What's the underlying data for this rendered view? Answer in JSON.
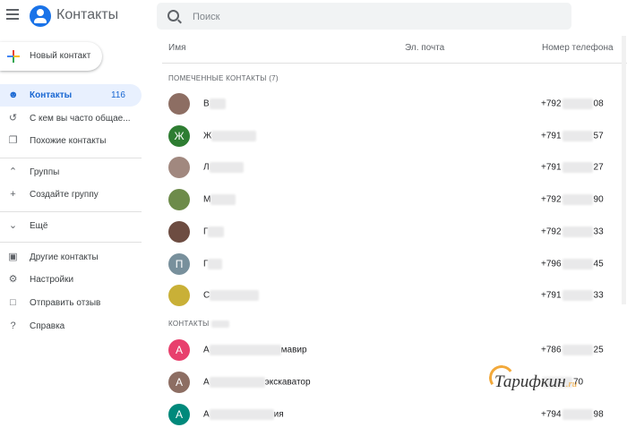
{
  "app": {
    "title": "Контакты"
  },
  "search": {
    "placeholder": "Поиск"
  },
  "new_contact": {
    "label": "Новый контакт"
  },
  "sidebar": {
    "items": [
      {
        "label": "Контакты",
        "count": "116",
        "icon": "person-icon"
      },
      {
        "label": "С кем вы часто общае...",
        "icon": "history-icon"
      },
      {
        "label": "Похожие контакты",
        "icon": "copy-icon"
      },
      {
        "label": "Группы",
        "icon": "chevron-up-icon"
      },
      {
        "label": "Создайте группу",
        "icon": "plus-icon"
      },
      {
        "label": "Ещё",
        "icon": "chevron-down-icon"
      },
      {
        "label": "Другие контакты",
        "icon": "archive-icon"
      },
      {
        "label": "Настройки",
        "icon": "gear-icon"
      },
      {
        "label": "Отправить отзыв",
        "icon": "feedback-icon"
      },
      {
        "label": "Справка",
        "icon": "help-icon"
      }
    ]
  },
  "columns": {
    "name": "Имя",
    "email": "Эл. почта",
    "phone": "Номер телефона"
  },
  "starred": {
    "title": "ПОМЕЧЕННЫЕ КОНТАКТЫ (7)",
    "rows": [
      {
        "initial": "",
        "name_start": "В",
        "name_end": "",
        "phone_start": "+792",
        "phone_end": "08",
        "avatar_color": "#8d6e63"
      },
      {
        "initial": "Ж",
        "name_start": "Ж",
        "name_end": "",
        "phone_start": "+791",
        "phone_end": "57",
        "avatar_color": "#2e7d32"
      },
      {
        "initial": "",
        "name_start": "Л",
        "name_end": "",
        "phone_start": "+791",
        "phone_end": "27",
        "avatar_color": "#a1887f"
      },
      {
        "initial": "",
        "name_start": "М",
        "name_end": "",
        "phone_start": "+792",
        "phone_end": "90",
        "avatar_color": "#6d8b4a"
      },
      {
        "initial": "",
        "name_start": "Г",
        "name_end": "",
        "phone_start": "+792",
        "phone_end": "33",
        "avatar_color": "#6d4c41"
      },
      {
        "initial": "П",
        "name_start": "Г",
        "name_end": "",
        "phone_start": "+796",
        "phone_end": "45",
        "avatar_color": "#78909c"
      },
      {
        "initial": "",
        "name_start": "С",
        "name_end": "",
        "phone_start": "+791",
        "phone_end": "33",
        "avatar_color": "#c9b037"
      }
    ]
  },
  "contacts": {
    "title": "КОНТАКТЫ",
    "rows": [
      {
        "initial": "А",
        "name_start": "А",
        "name_end": "мавир",
        "phone_start": "+786",
        "phone_end": "25",
        "avatar_color": "#e8406d"
      },
      {
        "initial": "А",
        "name_start": "А",
        "name_end": "экскаватор",
        "phone_start": "",
        "phone_end": "70",
        "avatar_color": "#8d6e63"
      },
      {
        "initial": "А",
        "name_start": "А",
        "name_end": "ия",
        "phone_start": "+794",
        "phone_end": "98",
        "avatar_color": "#00897b"
      }
    ]
  },
  "watermark": {
    "brand": "Тарифкин",
    "tld": ".ru"
  }
}
